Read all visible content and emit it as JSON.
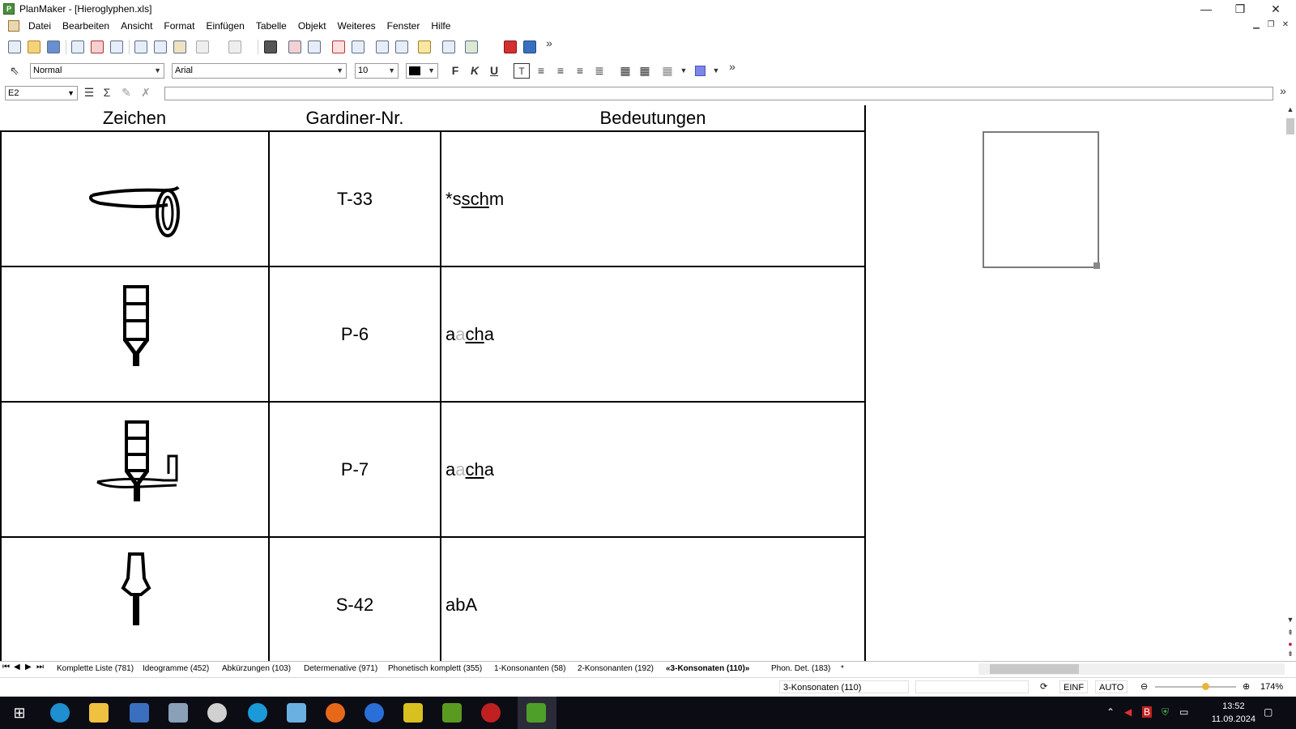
{
  "window": {
    "title": "PlanMaker - [Hieroglyphen.xls]",
    "app_icon": "P",
    "controls": [
      "—",
      "❐",
      "✕"
    ]
  },
  "menu": {
    "items": [
      "Datei",
      "Bearbeiten",
      "Ansicht",
      "Format",
      "Einfügen",
      "Tabelle",
      "Objekt",
      "Weiteres",
      "Fenster",
      "Hilfe"
    ]
  },
  "format_bar": {
    "style": "Normal",
    "font": "Arial",
    "size": "10",
    "bold": "F",
    "italic": "K",
    "underline": "U",
    "more": "»"
  },
  "formula_bar": {
    "cell_ref": "E2",
    "value": ""
  },
  "sheet": {
    "headers": [
      "Zeichen",
      "Gardiner-Nr.",
      "Bedeutungen"
    ],
    "rows": [
      {
        "glyph": "lasso-sign",
        "gardiner": "T-33",
        "meaning_parts": [
          {
            "t": "*",
            "s": ""
          },
          {
            "t": "s",
            "s": ""
          },
          {
            "t": "sch",
            "s": "ul"
          },
          {
            "t": "m",
            "s": ""
          }
        ]
      },
      {
        "glyph": "stand-sign",
        "gardiner": "P-6",
        "meaning_parts": [
          {
            "t": "a",
            "s": ""
          },
          {
            "t": "a",
            "s": "faint"
          },
          {
            "t": "ch",
            "s": "ul"
          },
          {
            "t": "a",
            "s": ""
          }
        ]
      },
      {
        "glyph": "mast-with-hand-sign",
        "gardiner": "P-7",
        "meaning_parts": [
          {
            "t": "a",
            "s": ""
          },
          {
            "t": "a",
            "s": "faint"
          },
          {
            "t": "ch",
            "s": "ul"
          },
          {
            "t": "a",
            "s": ""
          }
        ]
      },
      {
        "glyph": "baton-sign",
        "gardiner": "S-42",
        "meaning_parts": [
          {
            "t": "abA",
            "s": ""
          }
        ]
      }
    ]
  },
  "tabs": {
    "items": [
      "Komplette Liste (781)",
      "Ideogramme (452)",
      "Abkürzungen (103)",
      "Determenative (971)",
      "Phonetisch komplett (355)",
      "1-Konsonanten (58)",
      "2-Konsonanten (192)",
      "«3-Konsonaten (110)»",
      "Phon. Det. (183)",
      "*"
    ],
    "active_index": 7
  },
  "status": {
    "sheet": "3-Konsonaten (110)",
    "insert_mode": "EINF",
    "calc_mode": "AUTO",
    "zoom": "174%"
  },
  "taskbar": {
    "time": "13:52",
    "date": "11.09.2024"
  },
  "colors": {
    "grid_line": "#000000",
    "taskbar_bg": "#0c0c14",
    "faint_text": "#b8b8b8"
  }
}
